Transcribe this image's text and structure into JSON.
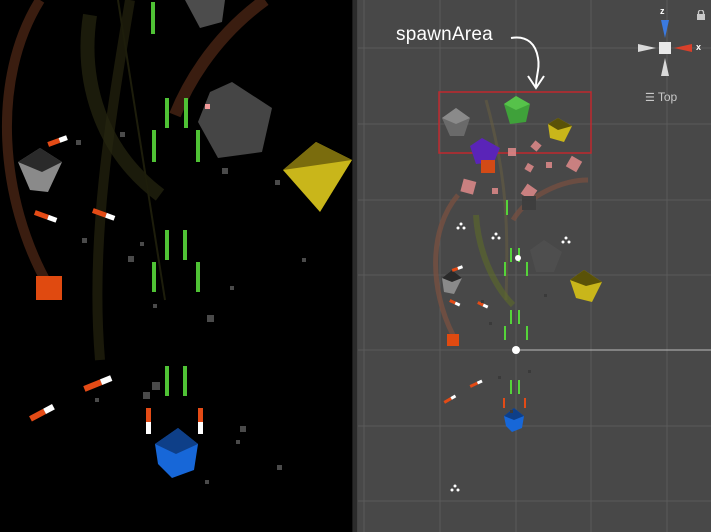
{
  "scene": {
    "annotation_label": "spawnArea",
    "view_mode_label": "Top",
    "gizmo": {
      "axis_z": "z",
      "axis_x": "x"
    }
  },
  "icons": [
    "lock-icon",
    "menu-icon",
    "orientation-gizmo-icon"
  ],
  "colors": {
    "spawn_area_outline": "#c0292e",
    "player_cube": "#1a6fe0",
    "enemy_yellow": "#d6c020",
    "enemy_gray": "#5c5c5c",
    "enemy_green": "#3fa13a",
    "enemy_purple": "#5a24b8",
    "laser": "#55d43a",
    "missile": "#e8501c"
  }
}
